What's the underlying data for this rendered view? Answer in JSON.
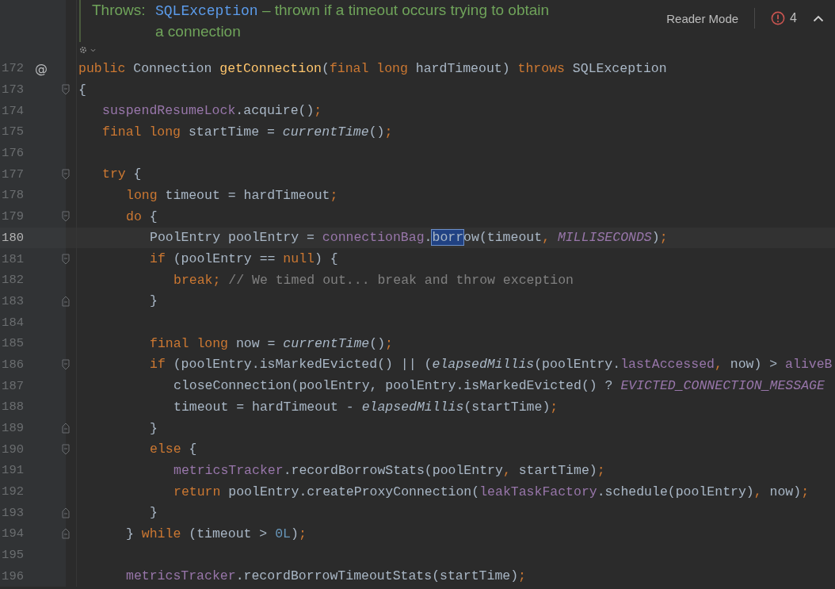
{
  "doc": {
    "label": "Throws:",
    "link": "SQLException",
    "lines": [
      "– thrown if a timeout occurs trying to obtain",
      "a connection"
    ]
  },
  "toolbar": {
    "reader_mode": "Reader Mode",
    "problem_count": "4"
  },
  "lines": [
    {
      "number": "172",
      "marker": "@",
      "kind": "plain",
      "current": false,
      "tokens": [
        {
          "kind": "kw",
          "text": "public "
        },
        {
          "kind": "plain",
          "text": "Connection "
        },
        {
          "kind": "decl",
          "text": "getConnection"
        },
        {
          "kind": "plain",
          "text": "("
        },
        {
          "kind": "kw",
          "text": "final long "
        },
        {
          "kind": "plain",
          "text": "hardTimeout) "
        },
        {
          "kind": "kw",
          "text": "throws "
        },
        {
          "kind": "plain",
          "text": "SQLException"
        }
      ]
    },
    {
      "number": "173",
      "kind": "opener",
      "current": false,
      "tokens": [
        {
          "kind": "plain",
          "text": "{"
        }
      ],
      "children": [
        {
          "number": "174",
          "kind": "plain",
          "current": false,
          "tokens": [
            {
              "kind": "field",
              "text": "suspendResumeLock"
            },
            {
              "kind": "plain",
              "text": ".acquire()"
            },
            {
              "kind": "kw",
              "text": ";"
            }
          ]
        },
        {
          "number": "175",
          "kind": "plain",
          "current": false,
          "tokens": [
            {
              "kind": "kw",
              "text": "final long "
            },
            {
              "kind": "plain",
              "text": "startTime = "
            },
            {
              "kind": "call",
              "text": "currentTime"
            },
            {
              "kind": "plain",
              "text": "()"
            },
            {
              "kind": "kw",
              "text": ";"
            }
          ]
        },
        {
          "number": "176",
          "kind": "plain",
          "current": false
        },
        {
          "number": "177",
          "kind": "opener",
          "current": false,
          "tokens": [
            {
              "kind": "kw",
              "text": "try "
            },
            {
              "kind": "plain",
              "text": "{"
            }
          ],
          "children": [
            {
              "number": "178",
              "kind": "plain",
              "current": false,
              "tokens": [
                {
                  "kind": "kw",
                  "text": "long "
                },
                {
                  "kind": "plain",
                  "text": "timeout = hardTimeout"
                },
                {
                  "kind": "kw",
                  "text": ";"
                }
              ]
            },
            {
              "number": "179",
              "kind": "opener",
              "current": false,
              "tokens": [
                {
                  "kind": "kw",
                  "text": "do "
                },
                {
                  "kind": "plain",
                  "text": "{"
                }
              ],
              "children": [
                {
                  "number": "180",
                  "kind": "plain",
                  "current": true,
                  "tokens": [
                    {
                      "kind": "plain",
                      "text": "PoolEntry poolEntry = "
                    },
                    {
                      "kind": "field",
                      "text": "connectionBag"
                    },
                    {
                      "kind": "plain",
                      "text": "."
                    },
                    {
                      "kind": "match",
                      "text": "borr"
                    },
                    {
                      "kind": "plain",
                      "text": "ow(timeout"
                    },
                    {
                      "kind": "kw",
                      "text": ", "
                    },
                    {
                      "kind": "const",
                      "text": "MILLISECONDS"
                    },
                    {
                      "kind": "plain",
                      "text": ")"
                    },
                    {
                      "kind": "kw",
                      "text": ";"
                    }
                  ]
                },
                {
                  "number": "181",
                  "kind": "opener",
                  "current": false,
                  "tokens": [
                    {
                      "kind": "kw",
                      "text": "if "
                    },
                    {
                      "kind": "plain",
                      "text": "(poolEntry == "
                    },
                    {
                      "kind": "kw",
                      "text": "null"
                    },
                    {
                      "kind": "plain",
                      "text": ") {"
                    }
                  ],
                  "children": [
                    {
                      "number": "182",
                      "kind": "plain",
                      "current": false,
                      "tokens": [
                        {
                          "kind": "kw",
                          "text": "break; "
                        },
                        {
                          "kind": "comment",
                          "text": "// We timed out... break and throw exception"
                        }
                      ]
                    }
                  ]
                },
                {
                  "number": "183",
                  "kind": "closer",
                  "current": false,
                  "tokens": [
                    {
                      "kind": "plain",
                      "text": "}"
                    }
                  ]
                },
                {
                  "number": "184",
                  "kind": "plain",
                  "current": false
                },
                {
                  "number": "185",
                  "kind": "plain",
                  "current": false,
                  "tokens": [
                    {
                      "kind": "kw",
                      "text": "final long "
                    },
                    {
                      "kind": "plain",
                      "text": "now = "
                    },
                    {
                      "kind": "call",
                      "text": "currentTime"
                    },
                    {
                      "kind": "plain",
                      "text": "()"
                    },
                    {
                      "kind": "kw",
                      "text": ";"
                    }
                  ]
                },
                {
                  "number": "186",
                  "kind": "opener",
                  "current": false,
                  "tokens": [
                    {
                      "kind": "kw",
                      "text": "if "
                    },
                    {
                      "kind": "plain",
                      "text": "(poolEntry.isMarkedEvicted() || ("
                    },
                    {
                      "kind": "call",
                      "text": "elapsedMillis"
                    },
                    {
                      "kind": "plain",
                      "text": "(poolEntry."
                    },
                    {
                      "kind": "field",
                      "text": "lastAccessed"
                    },
                    {
                      "kind": "kw",
                      "text": ", "
                    },
                    {
                      "kind": "plain",
                      "text": "now) > "
                    },
                    {
                      "kind": "field",
                      "text": "aliveB"
                    }
                  ],
                  "children": [
                    {
                      "number": "187",
                      "kind": "plain",
                      "current": false,
                      "tokens": [
                        {
                          "kind": "plain",
                          "text": "closeConnection(poolEntry, poolEntry.isMarkedEvicted() ? "
                        },
                        {
                          "kind": "const",
                          "text": "EVICTED_CONNECTION_MESSAGE"
                        }
                      ]
                    },
                    {
                      "number": "188",
                      "kind": "plain",
                      "current": false,
                      "tokens": [
                        {
                          "kind": "plain",
                          "text": "timeout = hardTimeout - "
                        },
                        {
                          "kind": "call",
                          "text": "elapsedMillis"
                        },
                        {
                          "kind": "plain",
                          "text": "(startTime)"
                        },
                        {
                          "kind": "kw",
                          "text": ";"
                        }
                      ]
                    }
                  ]
                },
                {
                  "number": "189",
                  "kind": "closer",
                  "current": false,
                  "tokens": [
                    {
                      "kind": "plain",
                      "text": "}"
                    }
                  ]
                },
                {
                  "number": "190",
                  "kind": "opener",
                  "current": false,
                  "tokens": [
                    {
                      "kind": "kw",
                      "text": "else "
                    },
                    {
                      "kind": "plain",
                      "text": "{"
                    }
                  ],
                  "children": [
                    {
                      "number": "191",
                      "kind": "plain",
                      "current": false,
                      "tokens": [
                        {
                          "kind": "field",
                          "text": "metricsTracker"
                        },
                        {
                          "kind": "plain",
                          "text": ".recordBorrowStats(poolEntry"
                        },
                        {
                          "kind": "kw",
                          "text": ", "
                        },
                        {
                          "kind": "plain",
                          "text": "startTime)"
                        },
                        {
                          "kind": "kw",
                          "text": ";"
                        }
                      ]
                    },
                    {
                      "number": "192",
                      "kind": "plain",
                      "current": false,
                      "tokens": [
                        {
                          "kind": "kw",
                          "text": "return "
                        },
                        {
                          "kind": "plain",
                          "text": "poolEntry.createProxyConnection("
                        },
                        {
                          "kind": "field",
                          "text": "leakTaskFactory"
                        },
                        {
                          "kind": "plain",
                          "text": ".schedule(poolEntry)"
                        },
                        {
                          "kind": "kw",
                          "text": ", "
                        },
                        {
                          "kind": "plain",
                          "text": "now)"
                        },
                        {
                          "kind": "kw",
                          "text": ";"
                        }
                      ]
                    }
                  ]
                },
                {
                  "number": "193",
                  "kind": "closer",
                  "current": false,
                  "tokens": [
                    {
                      "kind": "plain",
                      "text": "}"
                    }
                  ]
                }
              ]
            },
            {
              "number": "194",
              "kind": "closer",
              "current": false,
              "tokens": [
                {
                  "kind": "plain",
                  "text": "} "
                },
                {
                  "kind": "kw",
                  "text": "while "
                },
                {
                  "kind": "plain",
                  "text": "(timeout > "
                },
                {
                  "kind": "num",
                  "text": "0L"
                },
                {
                  "kind": "plain",
                  "text": ")"
                },
                {
                  "kind": "kw",
                  "text": ";"
                }
              ]
            },
            {
              "number": "195",
              "kind": "plain",
              "current": false
            },
            {
              "number": "196",
              "kind": "plain",
              "current": false,
              "tokens": [
                {
                  "kind": "field",
                  "text": "metricsTracker"
                },
                {
                  "kind": "plain",
                  "text": ".recordBorrowTimeoutStats(startTime)"
                },
                {
                  "kind": "kw",
                  "text": ";"
                }
              ]
            }
          ]
        }
      ]
    }
  ]
}
